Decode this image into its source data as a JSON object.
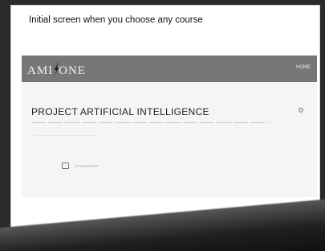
{
  "slide": {
    "caption": "Initial screen when you choose any course"
  },
  "app": {
    "logo": "AMIZONE",
    "logo_prefix": "AMI",
    "logo_suffix": "ONE",
    "nav_link": "HOME"
  },
  "course": {
    "title": "PROJECT ARTIFICIAL INTELLIGENCE",
    "settings_icon": "gear-icon"
  },
  "announcements": {
    "label": "Announcements",
    "icon": "announcement-icon"
  },
  "colors": {
    "appbar": "#777777",
    "page": "#ffffff"
  }
}
